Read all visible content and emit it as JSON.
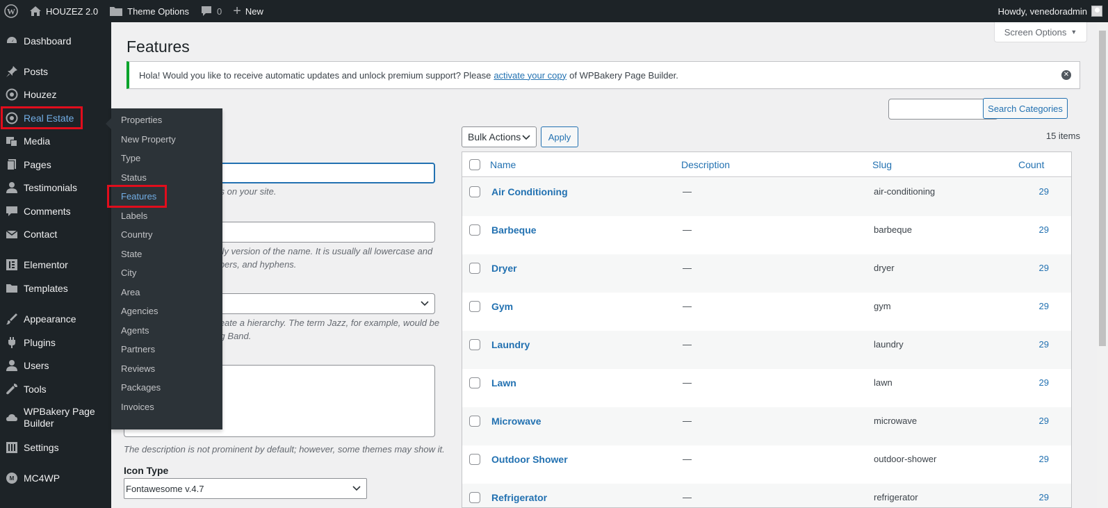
{
  "adminbar": {
    "site_name": "HOUZEZ 2.0",
    "theme_options": "Theme Options",
    "comments_count": "0",
    "new_label": "New",
    "howdy": "Howdy, venedoradmin"
  },
  "sidebar": {
    "items": [
      {
        "label": "Dashboard",
        "icon": "dashboard-icon"
      },
      {
        "label": "Posts",
        "icon": "pin-icon"
      },
      {
        "label": "Houzez",
        "icon": "location-icon"
      },
      {
        "label": "Real Estate",
        "icon": "location-icon"
      },
      {
        "label": "Media",
        "icon": "media-icon"
      },
      {
        "label": "Pages",
        "icon": "pages-icon"
      },
      {
        "label": "Testimonials",
        "icon": "user-icon"
      },
      {
        "label": "Comments",
        "icon": "comment-icon"
      },
      {
        "label": "Contact",
        "icon": "mail-icon"
      },
      {
        "label": "Elementor",
        "icon": "elementor-icon"
      },
      {
        "label": "Templates",
        "icon": "folder-icon"
      },
      {
        "label": "Appearance",
        "icon": "brush-icon"
      },
      {
        "label": "Plugins",
        "icon": "plugin-icon"
      },
      {
        "label": "Users",
        "icon": "user-icon"
      },
      {
        "label": "Tools",
        "icon": "wrench-icon"
      },
      {
        "label": "WPBakery Page",
        "label2": "Builder",
        "icon": "cloud-icon"
      },
      {
        "label": "Settings",
        "icon": "settings-icon"
      },
      {
        "label": "MC4WP",
        "icon": "mc4wp-icon"
      }
    ]
  },
  "flyout": {
    "items": [
      "Properties",
      "New Property",
      "Type",
      "Status",
      "Features",
      "Labels",
      "Country",
      "State",
      "City",
      "Area",
      "Agencies",
      "Agents",
      "Partners",
      "Reviews",
      "Packages",
      "Invoices"
    ]
  },
  "page": {
    "title": "Features",
    "screen_options": "Screen Options",
    "notice_before": "Hola! Would you like to receive automatic updates and unlock premium support? Please",
    "notice_link": "activate your copy",
    "notice_after": "of WPBakery Page Builder.",
    "search_button": "Search Categories",
    "bulk_actions": "Bulk Actions",
    "apply": "Apply",
    "items_count": "15 items"
  },
  "form": {
    "name_help": "ars on your site.",
    "slug_help_1": "ndly version of the name. It is usually all lowercase and",
    "slug_help_2": "mbers, and hyphens.",
    "parent_help_1": "create a hierarchy. The term Jazz, for example, would be",
    "parent_help_2": "Big Band.",
    "desc_help": "The description is not prominent by default; however, some themes may show it.",
    "icon_type_label": "Icon Type",
    "icon_type_value": "Fontawesome v.4.7"
  },
  "table": {
    "headers": {
      "name": "Name",
      "description": "Description",
      "slug": "Slug",
      "count": "Count"
    },
    "rows": [
      {
        "name": "Air Conditioning",
        "description": "—",
        "slug": "air-conditioning",
        "count": "29"
      },
      {
        "name": "Barbeque",
        "description": "—",
        "slug": "barbeque",
        "count": "29"
      },
      {
        "name": "Dryer",
        "description": "—",
        "slug": "dryer",
        "count": "29"
      },
      {
        "name": "Gym",
        "description": "—",
        "slug": "gym",
        "count": "29"
      },
      {
        "name": "Laundry",
        "description": "—",
        "slug": "laundry",
        "count": "29"
      },
      {
        "name": "Lawn",
        "description": "—",
        "slug": "lawn",
        "count": "29"
      },
      {
        "name": "Microwave",
        "description": "—",
        "slug": "microwave",
        "count": "29"
      },
      {
        "name": "Outdoor Shower",
        "description": "—",
        "slug": "outdoor-shower",
        "count": "29"
      },
      {
        "name": "Refrigerator",
        "description": "—",
        "slug": "refrigerator",
        "count": "29"
      }
    ]
  },
  "colors": {
    "adminbar_bg": "#1d2327",
    "link": "#2271b1",
    "highlight_box": "#e10d1c",
    "notice_border": "#00a32a"
  }
}
